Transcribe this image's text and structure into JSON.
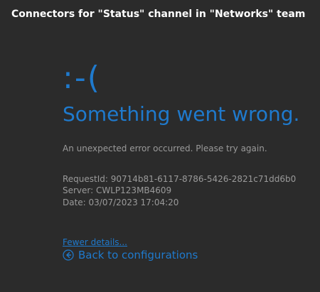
{
  "dialog": {
    "title": "Connectors for \"Status\" channel in \"Networks\" team"
  },
  "error": {
    "emoticon": ":-(",
    "headline": "Something went wrong.",
    "message": "An unexpected error occurred. Please try again.",
    "request_id": "RequestId: 90714b81-6117-8786-5426-2821c71dd6b0",
    "server": "Server: CWLP123MB4609",
    "date": "Date: 03/07/2023 17:04:20"
  },
  "links": {
    "fewer_details": "Fewer details...",
    "back_to_configurations": "Back to configurations"
  },
  "colors": {
    "accent": "#1f7acd",
    "background": "#2b2b2b",
    "muted_text": "#9a9a9a",
    "title_text": "#ffffff"
  },
  "icons": {
    "back": "circle-left-arrow-icon"
  }
}
